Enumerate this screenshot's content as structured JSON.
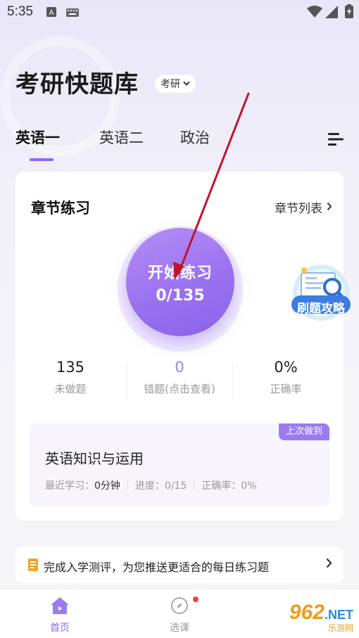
{
  "status_bar": {
    "time": "5:35"
  },
  "header": {
    "title": "考研快题库",
    "exam_selector": "考研"
  },
  "tabs": [
    {
      "label": "英语一"
    },
    {
      "label": "英语二"
    },
    {
      "label": "政治"
    }
  ],
  "practice_card": {
    "title": "章节练习",
    "chapter_list_link": "章节列表",
    "start_button": {
      "label": "开始练习",
      "progress": "0/135"
    },
    "guide_badge": "刷题攻略",
    "stats": [
      {
        "value": "135",
        "label": "未做题"
      },
      {
        "value": "0",
        "label": "错题(点击查看)"
      },
      {
        "value": "0%",
        "label": "正确率"
      }
    ],
    "last_session": {
      "tag": "上次做到",
      "title": "英语知识与运用",
      "recent_label": "最近学习：",
      "recent_value": "0分钟",
      "progress": "进度：0/15",
      "accuracy": "正确率：0%"
    }
  },
  "banner": {
    "text": "完成入学测评，为您推送更适合的每日练习题"
  },
  "bottom_nav": {
    "items": [
      {
        "label": "首页"
      },
      {
        "label": "选课"
      }
    ],
    "watermark": {
      "main": "962",
      "net": ".NET",
      "sub": "乐游网"
    }
  },
  "colors": {
    "accent": "#8b6cf0",
    "button_start": "#b38ff7",
    "button_end": "#8a62ea",
    "error_count": "#9c86e6",
    "arrow": "#c0142a"
  }
}
